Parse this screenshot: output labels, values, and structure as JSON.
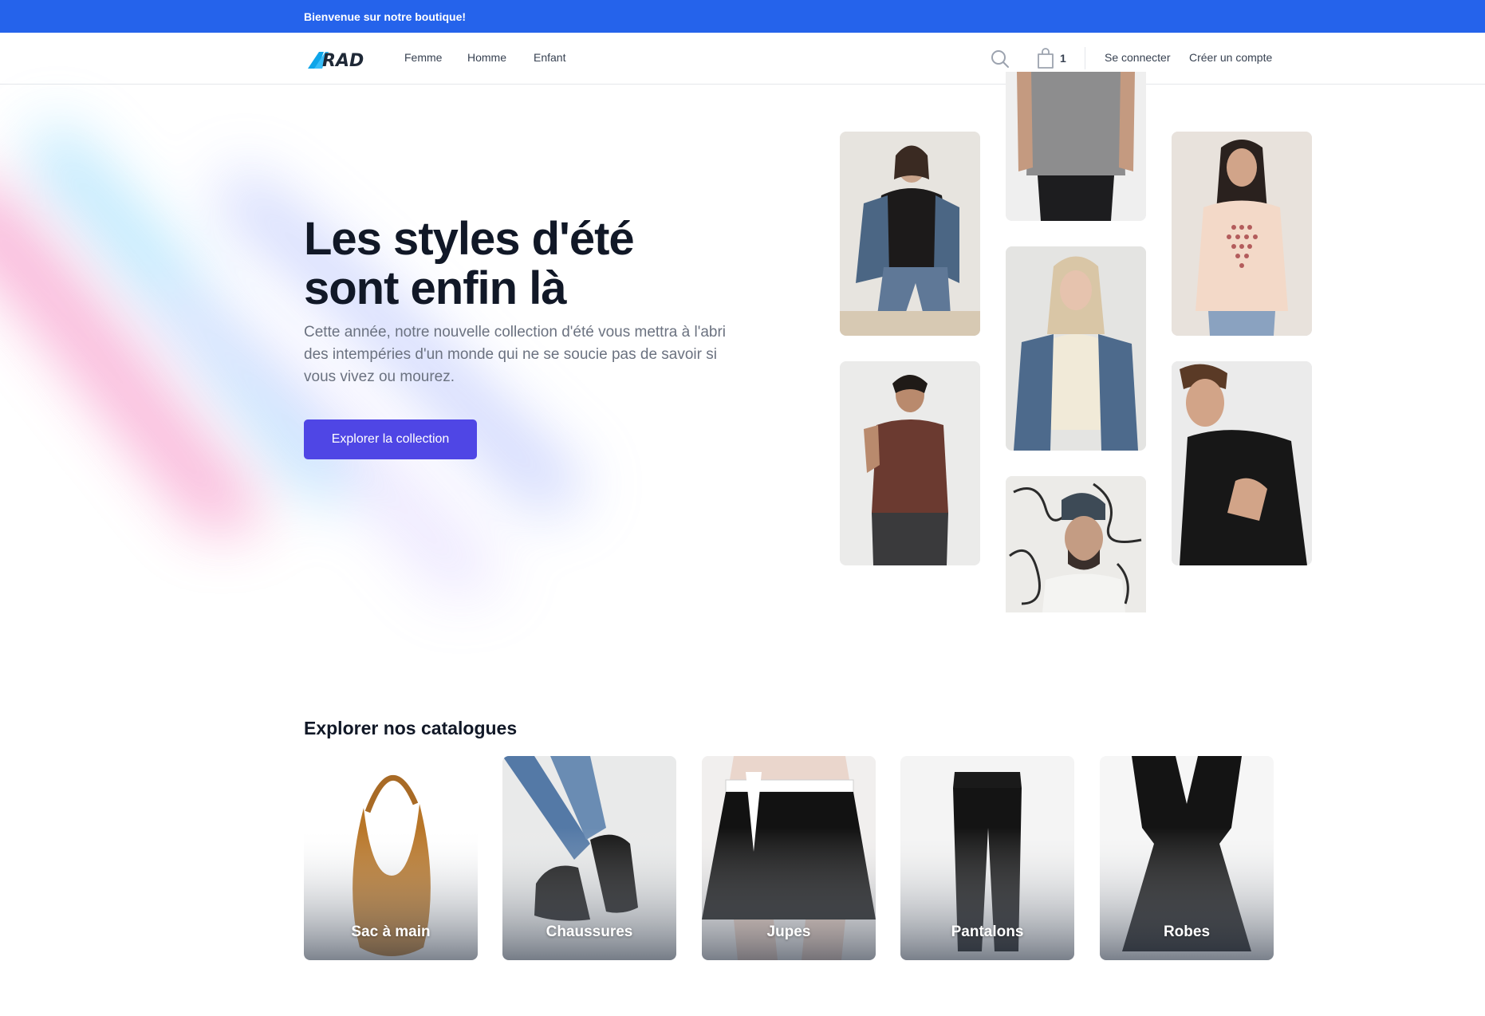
{
  "topbar": {
    "text": "Bienvenue sur notre boutique!"
  },
  "nav": {
    "logo_text": "RAD",
    "links": [
      "Femme",
      "Homme",
      "Enfant"
    ],
    "cart_count": "1",
    "login": "Se connecter",
    "signup": "Créer un compte"
  },
  "hero": {
    "title_line1": "Les styles d'été",
    "title_line2": "sont enfin là",
    "description": "Cette année, notre nouvelle collection d'été vous mettra à l'abri des intempéries d'un monde qui ne se soucie pas de savoir si vous vivez ou mourez.",
    "cta": "Explorer la collection"
  },
  "catalog": {
    "title": "Explorer nos catalogues",
    "items": [
      "Sac à main",
      "Chaussures",
      "Jupes",
      "Pantalons",
      "Robes"
    ]
  },
  "icons": {
    "search": "search-icon",
    "cart": "shopping-bag-icon",
    "logo": "rad-logo"
  },
  "colors": {
    "topbar": "#2563eb",
    "cta": "#4f46e5",
    "text": "#111827",
    "muted": "#6b7280"
  }
}
